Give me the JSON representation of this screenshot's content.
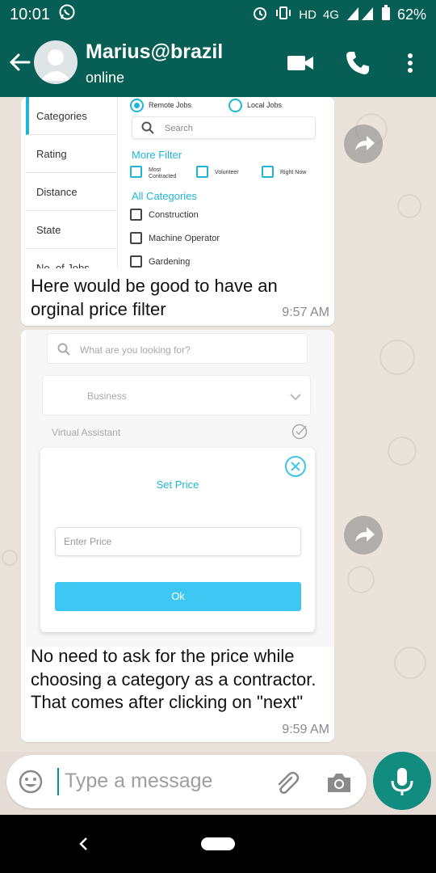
{
  "status_bar": {
    "time": "10:01",
    "network": "HD",
    "network_type": "4G",
    "battery": "62%",
    "icons": [
      "whatsapp-icon",
      "alarm-icon",
      "vibrate-icon",
      "signal-icon",
      "battery-icon"
    ]
  },
  "header": {
    "contact_name": "Marius@brazil",
    "contact_status": "online",
    "icons": [
      "back-arrow-icon",
      "video-call-icon",
      "phone-icon",
      "more-vert-icon"
    ]
  },
  "messages": [
    {
      "type": "image",
      "caption": "Here would be good to have an orginal price filter",
      "time": "9:57 AM",
      "screenshot": {
        "sidebar_items": [
          "Categories",
          "Rating",
          "Distance",
          "State",
          "No. of Jobs"
        ],
        "active_item": "Categories",
        "job_types": [
          {
            "label": "Remote Jobs",
            "selected": true
          },
          {
            "label": "Local Jobs",
            "selected": false
          }
        ],
        "search_placeholder": "Search",
        "more_filter_title": "More Filter",
        "more_filters": [
          "Most Contracted",
          "Volunteer",
          "Right Now"
        ],
        "categories_title": "All Categories",
        "categories": [
          "Construction",
          "Machine Operator",
          "Gardening"
        ]
      }
    },
    {
      "type": "image",
      "caption": "No need to ask for the price while choosing a category as a contractor.  That comes after clicking on  \"next\"",
      "time": "9:59 AM",
      "screenshot": {
        "search_placeholder": "What are you looking for?",
        "category_selected": "Business",
        "subcategory": "Virtual Assistant",
        "modal_title": "Set Price",
        "price_placeholder": "Enter Price",
        "ok_label": "Ok"
      }
    }
  ],
  "input_bar": {
    "placeholder": "Type a message",
    "icons": [
      "emoji-icon",
      "attach-icon",
      "camera-icon",
      "mic-icon"
    ]
  },
  "colors": {
    "header_green": "#075e54",
    "accent_teal": "#128c7e",
    "chat_bg": "#e9e3db",
    "app_cyan": "#1fb6d6"
  }
}
